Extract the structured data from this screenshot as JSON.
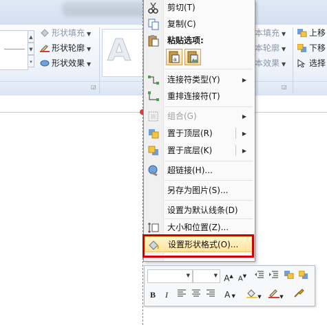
{
  "ribbon": {
    "shape_fill": "形状填充",
    "shape_outline": "形状轮廓",
    "shape_effects": "形状效果",
    "wordart_letter": "A",
    "text_fill": "本填充",
    "text_outline": "本轮廓",
    "text_effects": "本效果",
    "bring_forward": "上移",
    "send_backward": "下移",
    "selection_pane": "选择"
  },
  "context_menu": {
    "cut": "剪切(T)",
    "copy": "复制(C)",
    "paste_options": "粘贴选项:",
    "connector_type": "连接符类型(Y)",
    "reroute_connectors": "重排连接符(T)",
    "group": "组合(G)",
    "bring_to_front": "置于顶层(R)",
    "send_to_back": "置于底层(K)",
    "hyperlink": "超链接(H)...",
    "save_as_picture": "另存为图片(S)...",
    "set_default_line": "设置为默认线条(D)",
    "size_position": "大小和位置(Z)...",
    "format_shape": "设置形状格式(O)..."
  },
  "mini_toolbar": {
    "bold": "B",
    "italic": "I",
    "grow_font": "A",
    "shrink_font": "A",
    "font_color": "A"
  },
  "colors": {
    "highlight_frame": "#d00000",
    "menu_hover": "#fde49a",
    "ribbon_bg": "#eef3fa"
  }
}
